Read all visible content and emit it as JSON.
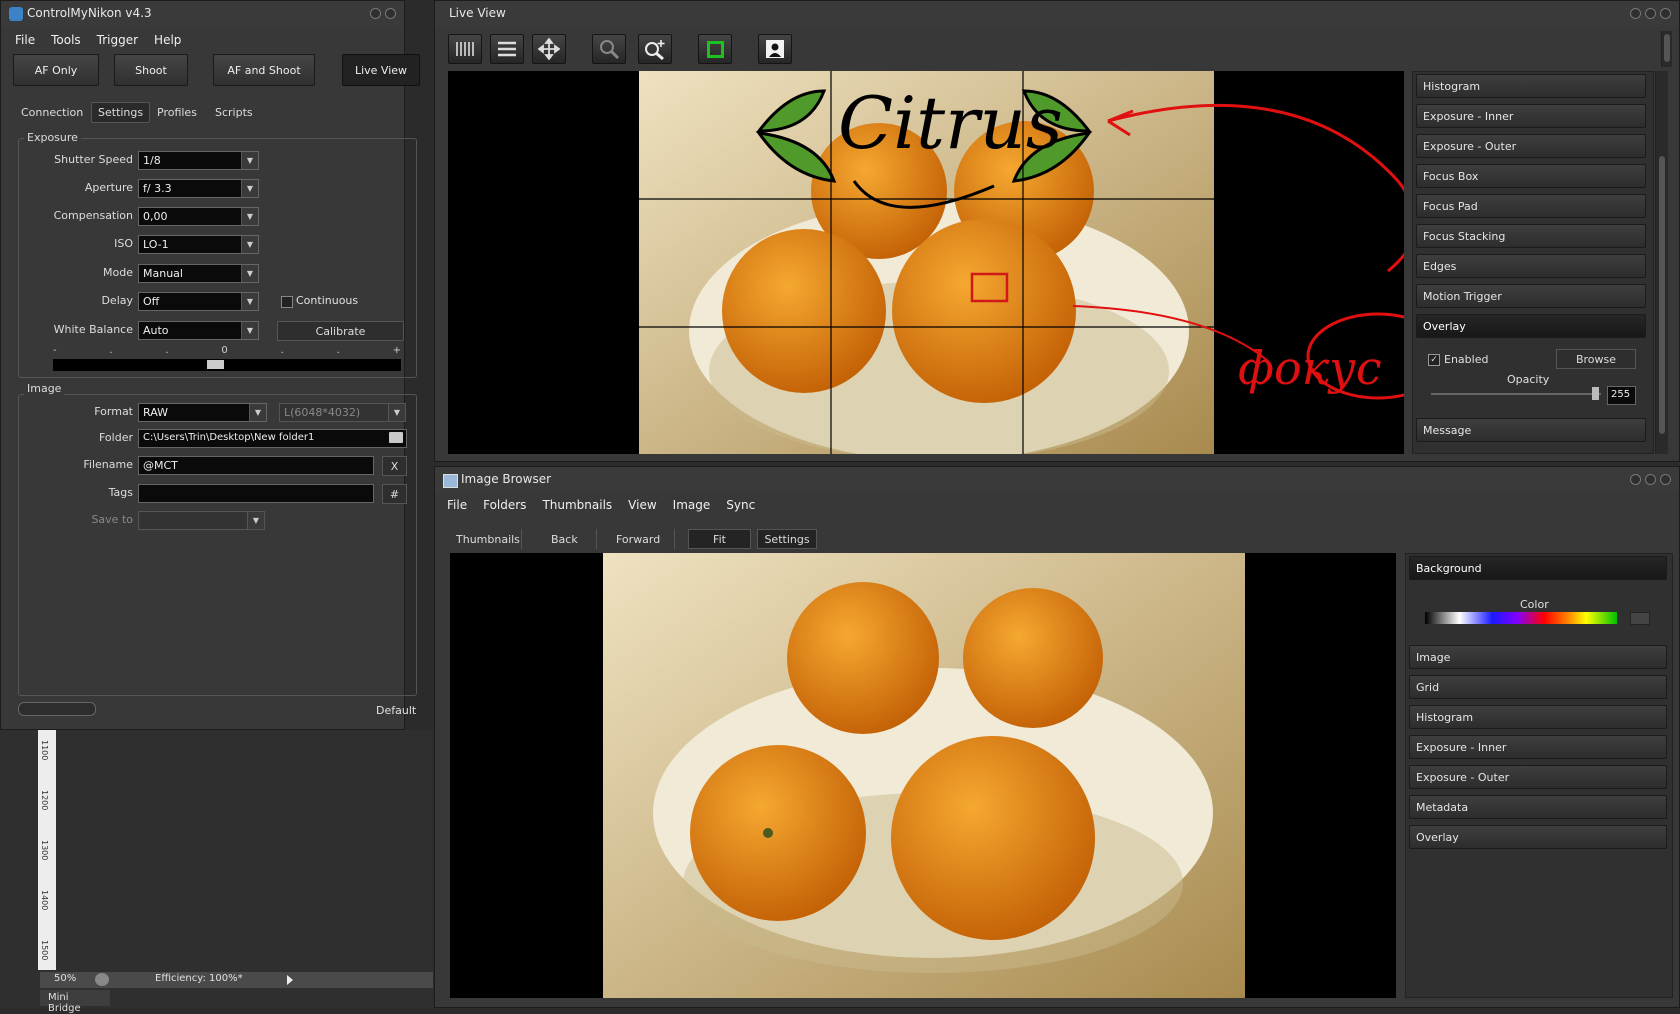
{
  "left": {
    "title": "ControlMyNikon v4.3",
    "menu": [
      "File",
      "Tools",
      "Trigger",
      "Help"
    ],
    "buttons": {
      "af_only": "AF Only",
      "shoot": "Shoot",
      "af_and_shoot": "AF and Shoot",
      "live_view": "Live View"
    },
    "tabs": [
      "Connection",
      "Settings",
      "Profiles",
      "Scripts"
    ],
    "exposure": {
      "group": "Exposure",
      "shutter_label": "Shutter Speed",
      "shutter": "1/8",
      "aperture_label": "Aperture",
      "aperture": "f/ 3.3",
      "comp_label": "Compensation",
      "comp": "0,00",
      "iso_label": "ISO",
      "iso": "LO-1",
      "mode_label": "Mode",
      "mode": "Manual",
      "delay_label": "Delay",
      "delay": "Off",
      "continuous": "Continuous",
      "wb_label": "White Balance",
      "wb": "Auto",
      "calibrate": "Calibrate",
      "scale": [
        "-",
        ".",
        ".",
        "0",
        ".",
        ".",
        "+"
      ]
    },
    "image": {
      "group": "Image",
      "format_label": "Format",
      "format": "RAW",
      "size": "L(6048*4032)",
      "folder_label": "Folder",
      "folder": "C:\\Users\\Trin\\Desktop\\New folder1",
      "filename_label": "Filename",
      "filename": "@MCT",
      "clear": "X",
      "tags_label": "Tags",
      "tags": "",
      "hash": "#",
      "saveto_label": "Save to"
    },
    "default": "Default"
  },
  "ruler": {
    "marks": [
      "1100",
      "1200",
      "1300",
      "1400",
      "1500"
    ]
  },
  "status": {
    "zoom": "50%",
    "efficiency": "Efficiency: 100%*",
    "minibridge": "Mini Bridge"
  },
  "liveview": {
    "title": "Live View",
    "panel": [
      "Histogram",
      "Exposure - Inner",
      "Exposure - Outer",
      "Focus Box",
      "Focus Pad",
      "Focus Stacking",
      "Edges",
      "Motion Trigger",
      "Overlay"
    ],
    "enabled": "Enabled",
    "browse": "Browse",
    "opacity_label": "Opacity",
    "opacity": "255",
    "message": "Message",
    "overlay_text": "Citrus",
    "annotation": "фокус"
  },
  "browser": {
    "title": "Image Browser",
    "menu": [
      "File",
      "Folders",
      "Thumbnails",
      "View",
      "Image",
      "Sync"
    ],
    "toolbar": [
      "Thumbnails",
      "Back",
      "Forward",
      "Fit",
      "Settings"
    ],
    "background": "Background",
    "color_label": "Color",
    "panel": [
      "Image",
      "Grid",
      "Histogram",
      "Exposure - Inner",
      "Exposure - Outer",
      "Metadata",
      "Overlay"
    ]
  },
  "colors": {
    "accent_green": "#1ec21e",
    "annotation_red": "#e01010",
    "focus_box": "#d01818"
  }
}
